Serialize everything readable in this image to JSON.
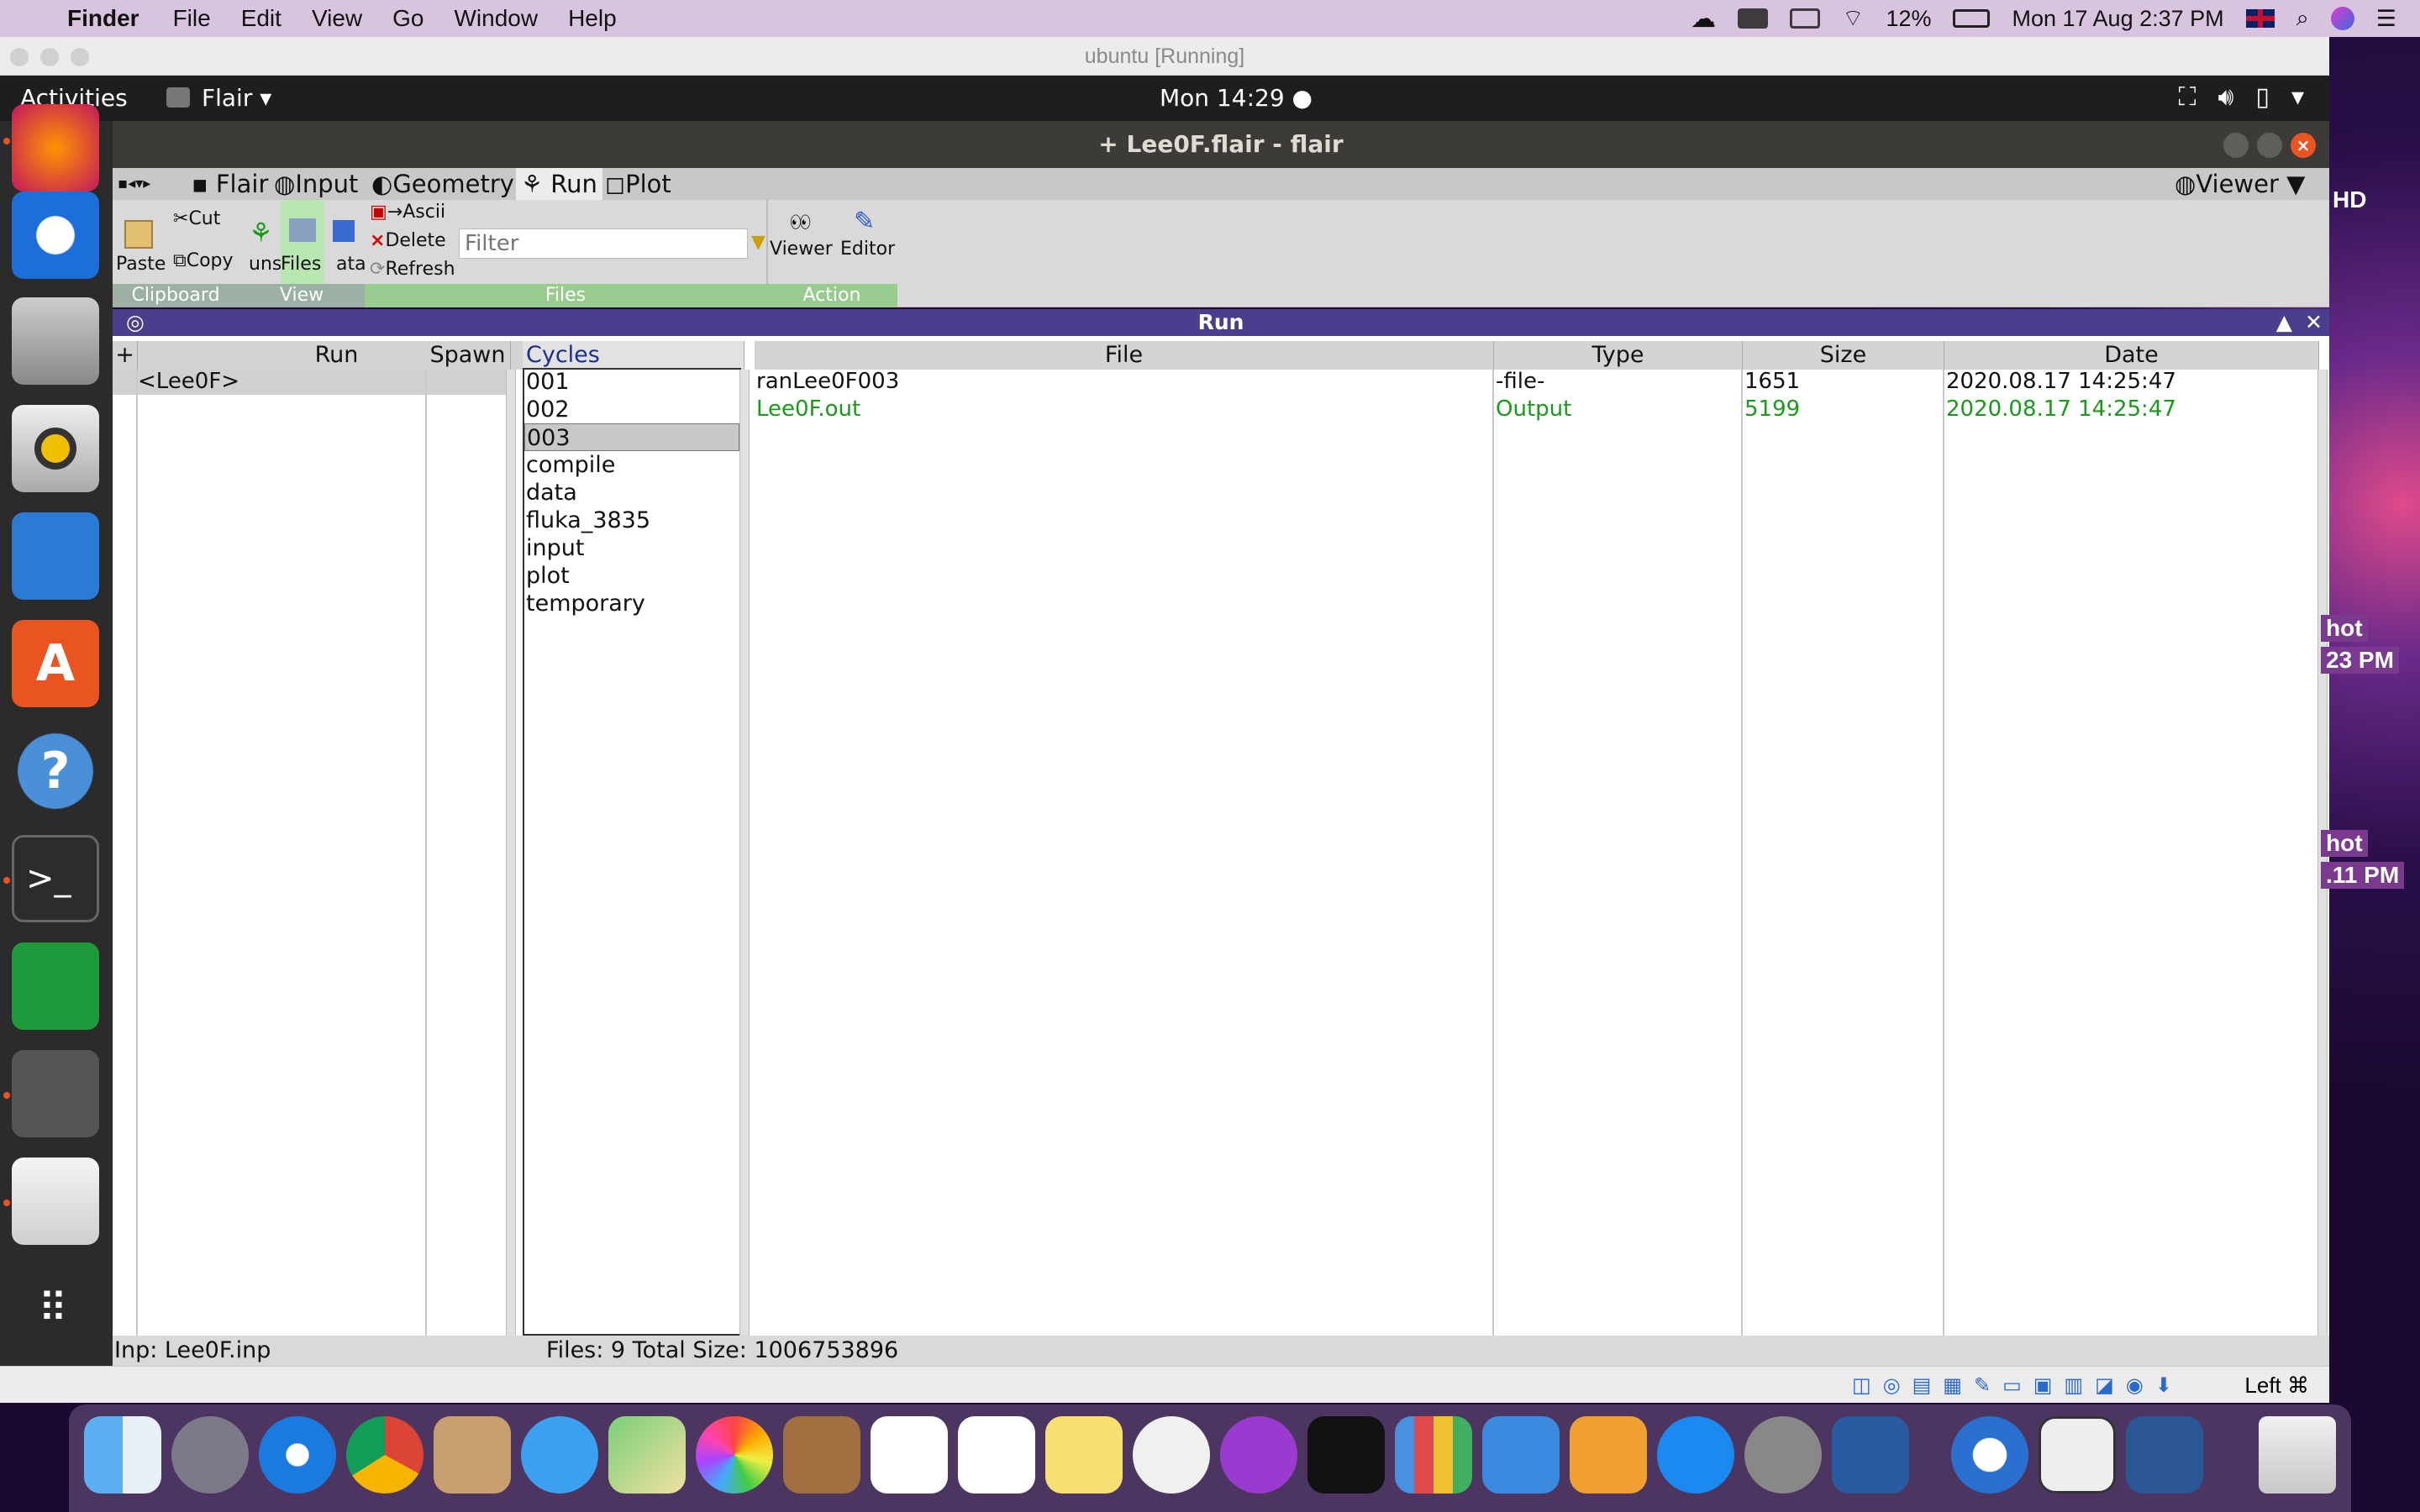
{
  "mac_menubar": {
    "app": "Finder",
    "items": [
      "File",
      "Edit",
      "View",
      "Go",
      "Window",
      "Help"
    ],
    "battery": "12%",
    "datetime": "Mon 17 Aug  2:37 PM"
  },
  "vbox": {
    "title": "ubuntu [Running]",
    "host_key": "Left ⌘"
  },
  "ubuntu": {
    "activities": "Activities",
    "app_menu": "Flair ▾",
    "clock": "Mon 14:29 ●"
  },
  "flair": {
    "title": "+ Lee0F.flair - flair",
    "tabs": [
      "Flair",
      "Input",
      "Geometry",
      "Run",
      "Plot"
    ],
    "viewer_tab": "Viewer ▼",
    "ribbon": {
      "paste": "Paste",
      "cut": "Cut",
      "copy": "Copy",
      "uns": "uns",
      "files": "Files",
      "ata": "ata",
      "ascii": "→Ascii",
      "delete": "Delete",
      "refresh": "Refresh",
      "filter_placeholder": "Filter",
      "viewer": "Viewer",
      "editor": "Editor",
      "groups": [
        "Clipboard",
        "View",
        "Files",
        "Action"
      ]
    },
    "panel_title": "Run",
    "columns": {
      "plus": "+",
      "run": "Run",
      "spawn": "Spawn",
      "cycles": "Cycles",
      "file": "File",
      "type": "Type",
      "size": "Size",
      "date": "Date"
    },
    "run_rows": [
      "<Lee0F>"
    ],
    "cycles": [
      "001",
      "002",
      "003",
      "compile",
      "data",
      "fluka_3835",
      "input",
      "plot",
      "temporary"
    ],
    "files": [
      {
        "file": "ranLee0F003",
        "type": "-file-",
        "size": "1651",
        "date": "2020.08.17 14:25:47"
      },
      {
        "file": "Lee0F.out",
        "type": "Output",
        "size": "5199",
        "date": "2020.08.17 14:25:47"
      }
    ],
    "status_left": "Inp: Lee0F.inp",
    "status_right": "Files: 9 Total Size: 1006753896"
  },
  "desktop": {
    "hd": "HD",
    "shot1_a": "hot",
    "shot1_b": "23 PM",
    "shot2_a": "hot",
    "shot2_b": ".11 PM"
  },
  "colors": {
    "accent": "#4a3f8c",
    "ubuntu_orange": "#e95420",
    "output_green": "#1a9a1a"
  }
}
